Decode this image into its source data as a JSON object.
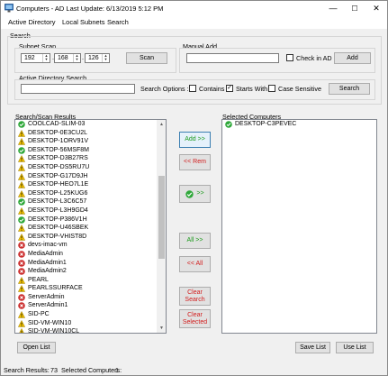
{
  "window": {
    "title": "Computers - AD Last Update: 6/13/2019 5:12 PM",
    "controls": {
      "minimize": "—",
      "maximize": "☐",
      "close": "✕"
    }
  },
  "menu": [
    "Active Directory",
    "Local Subnets",
    "Search"
  ],
  "search": {
    "group_label": "Search",
    "subnet_scan_label": "Subnet Scan",
    "octets": [
      "192",
      "168",
      "126"
    ],
    "scan_button": "Scan",
    "manual_add_label": "Manual Add",
    "manual_add_value": "",
    "check_in_ad_label": "Check in AD",
    "add_button": "Add",
    "ad_search_label": "Active Directory Search",
    "ad_search_value": "",
    "options_label": "Search Options :",
    "contains_label": "Contains",
    "starts_with_label": "Starts With",
    "case_sensitive_label": "Case Sensitive",
    "search_button": "Search"
  },
  "results": {
    "label": "Search/Scan Results",
    "items": [
      {
        "name": "COOLCAD-SLIM-03",
        "status": "ok"
      },
      {
        "name": "DESKTOP-0E3CU2L",
        "status": "warn"
      },
      {
        "name": "DESKTOP-1ORV91V",
        "status": "warn"
      },
      {
        "name": "DESKTOP-56MSF8M",
        "status": "ok"
      },
      {
        "name": "DESKTOP-D3B27RS",
        "status": "warn"
      },
      {
        "name": "DESKTOP-DS5RU7U",
        "status": "warn"
      },
      {
        "name": "DESKTOP-G17D9JH",
        "status": "warn"
      },
      {
        "name": "DESKTOP-HEO7L1E",
        "status": "warn"
      },
      {
        "name": "DESKTOP-L25KUG6",
        "status": "warn"
      },
      {
        "name": "DESKTOP-L3C6C57",
        "status": "ok"
      },
      {
        "name": "DESKTOP-L3H9GD4",
        "status": "warn"
      },
      {
        "name": "DESKTOP-P386V1H",
        "status": "ok"
      },
      {
        "name": "DESKTOP-U46SBEK",
        "status": "warn"
      },
      {
        "name": "DESKTOP-VHIST8D",
        "status": "warn"
      },
      {
        "name": "devs-imac-vm",
        "status": "err"
      },
      {
        "name": "MediaAdmin",
        "status": "err"
      },
      {
        "name": "MediaAdmin1",
        "status": "err"
      },
      {
        "name": "MediaAdmin2",
        "status": "err"
      },
      {
        "name": "PEARL",
        "status": "warn"
      },
      {
        "name": "PEARLSSURFACE",
        "status": "warn"
      },
      {
        "name": "ServerAdmin",
        "status": "err"
      },
      {
        "name": "ServerAdmin1",
        "status": "err"
      },
      {
        "name": "SID-PC",
        "status": "warn"
      },
      {
        "name": "SID-VM-WIN10",
        "status": "warn"
      },
      {
        "name": "SID-VM-WIN10CL",
        "status": "warn"
      }
    ]
  },
  "middle_buttons": {
    "add": "Add >>",
    "remove": "<< Rem",
    "add_ok": ">>",
    "all_add": "All >>",
    "all_remove": "<< All",
    "clear_search": "Clear Search",
    "clear_selected": "Clear Selected"
  },
  "selected": {
    "label": "Selected Computers",
    "items": [
      {
        "name": "DESKTOP-C3PEVEC",
        "status": "ok"
      }
    ]
  },
  "bottom_buttons": {
    "open_list": "Open List",
    "save_list": "Save List",
    "use_list": "Use List"
  },
  "status": {
    "search_results_label": "Search Results:",
    "search_results_count": "73",
    "selected_label": "Selected Computers:",
    "selected_count": "1"
  },
  "colors": {
    "ok": "#2fa83a",
    "warn": "#f2c200",
    "err": "#cc2d2d",
    "accent_green": "#1a9a1a",
    "accent_red": "#d21d1d"
  },
  "icons": {
    "ok": "green-check-circle-icon",
    "warn": "yellow-warning-triangle-icon",
    "err": "red-x-circle-icon",
    "app": "computer-app-icon"
  }
}
